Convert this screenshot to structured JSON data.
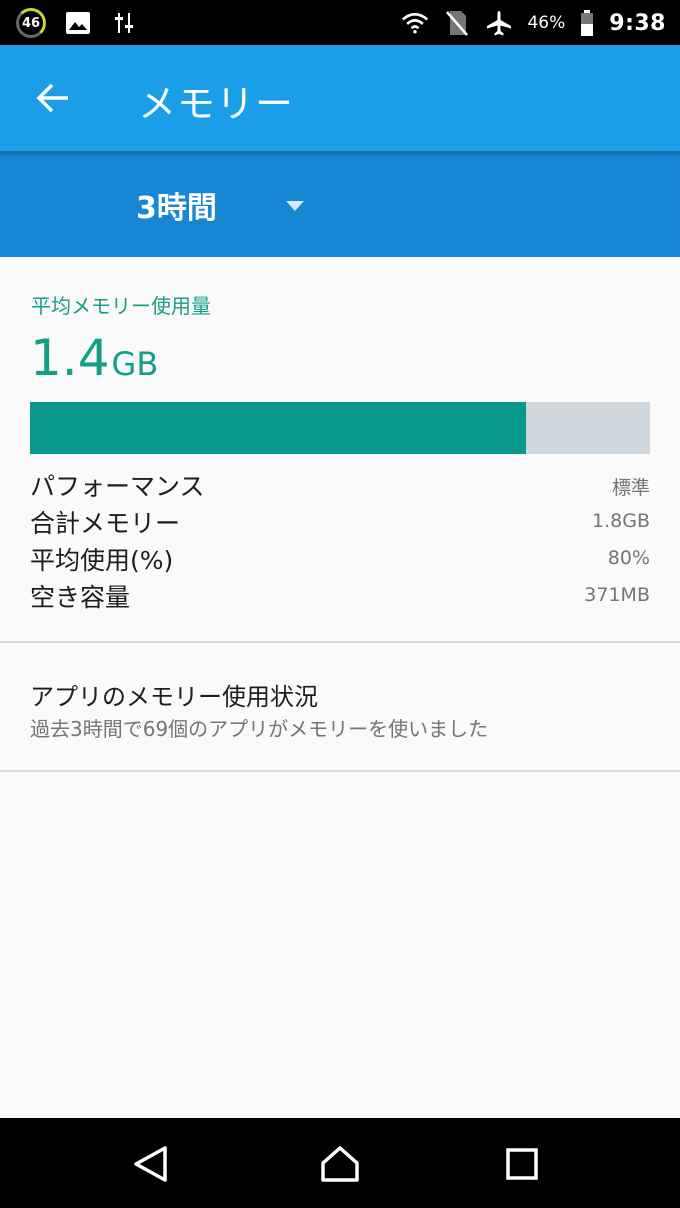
{
  "status_bar": {
    "notification_count": "46",
    "battery_percent": "46%",
    "time": "9:38",
    "icons": [
      "notification-count-icon",
      "gallery-icon",
      "settings-sliders-icon",
      "wifi-icon",
      "no-sim-icon",
      "airplane-mode-icon",
      "battery-icon"
    ]
  },
  "app_bar": {
    "title": "メモリー",
    "back_icon": "arrow-back-icon",
    "color": "#1a9ee8"
  },
  "filter": {
    "selected": "3時間",
    "caret_icon": "dropdown-caret-icon",
    "color": "#1787d3"
  },
  "summary": {
    "label": "平均メモリー使用量",
    "value": "1.4",
    "unit": "GB",
    "usage_fraction": 0.8,
    "accent_color": "#139f86"
  },
  "stats": [
    {
      "label": "パフォーマンス",
      "value": "標準"
    },
    {
      "label": "合計メモリー",
      "value": "1.8GB"
    },
    {
      "label": "平均使用(%)",
      "value": "80%"
    },
    {
      "label": "空き容量",
      "value": "371MB"
    }
  ],
  "app_usage": {
    "title": "アプリのメモリー使用状況",
    "subtitle": "過去3時間で69個のアプリがメモリーを使いました"
  },
  "nav_bar": {
    "icons": [
      "back-triangle-icon",
      "home-icon",
      "recents-icon"
    ]
  }
}
